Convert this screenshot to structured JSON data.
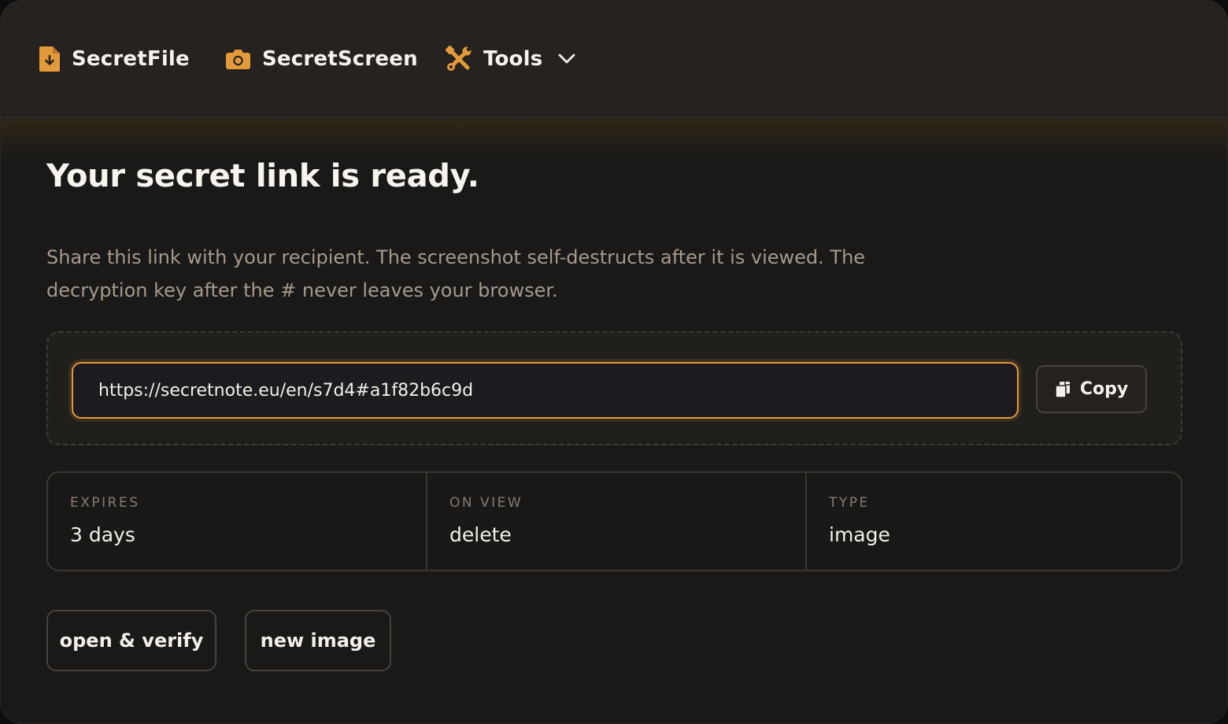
{
  "nav": {
    "items": [
      {
        "label": "SecretFile",
        "icon": "file-download-icon"
      },
      {
        "label": "SecretScreen",
        "icon": "camera-icon"
      },
      {
        "label": "Tools",
        "icon": "tools-icon",
        "dropdown": true
      }
    ]
  },
  "main": {
    "title": "Your secret link is ready.",
    "description": "Share this link with your recipient. The screenshot self-destructs after it is viewed. The decryption key after the # never leaves your browser.",
    "link": {
      "value": "https://secretnote.eu/en/s7d4#a1f82b6c9d",
      "copy_label": "Copy",
      "copy_icon": "copy-icon"
    },
    "meta": [
      {
        "label": "EXPIRES",
        "value": "3 days"
      },
      {
        "label": "ON VIEW",
        "value": "delete"
      },
      {
        "label": "TYPE",
        "value": "image"
      }
    ],
    "actions": {
      "open_verify": "open & verify",
      "new_image": "new image"
    }
  },
  "colors": {
    "accent": "#e39a3a",
    "background": "#1b1917",
    "nav_background": "#252220",
    "muted_text": "#a59a8c"
  }
}
